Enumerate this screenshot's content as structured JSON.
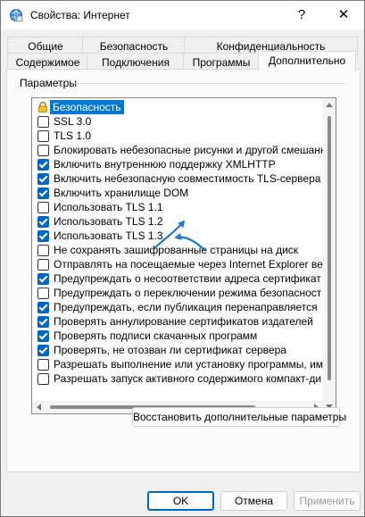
{
  "window": {
    "title": "Свойства: Интернет",
    "help_label": "?",
    "close_label": "✕"
  },
  "tabs": {
    "row1": [
      "Общие",
      "Безопасность",
      "Конфиденциальность"
    ],
    "row2": [
      "Содержимое",
      "Подключения",
      "Программы",
      "Дополнительно"
    ],
    "active": "Дополнительно"
  },
  "settings": {
    "group_label": "Параметры",
    "category": "Безопасность",
    "items": [
      {
        "label": "SSL 3.0",
        "checked": false
      },
      {
        "label": "TLS 1.0",
        "checked": false
      },
      {
        "label": "Блокировать небезопасные рисунки и другой смешанн",
        "checked": false
      },
      {
        "label": "Включить внутреннюю поддержку XMLHTTP",
        "checked": true
      },
      {
        "label": "Включить небезопасную совместимость TLS-сервера",
        "checked": true
      },
      {
        "label": "Включить хранилище DOM",
        "checked": true
      },
      {
        "label": "Использовать TLS 1.1",
        "checked": false
      },
      {
        "label": "Использовать TLS 1.2",
        "checked": true
      },
      {
        "label": "Использовать TLS 1.3",
        "checked": true
      },
      {
        "label": "Не сохранять зашифрованные страницы на диск",
        "checked": false
      },
      {
        "label": "Отправлять на посещаемые через Internet Explorer ве",
        "checked": false
      },
      {
        "label": "Предупреждать о несоответствии адреса сертификат",
        "checked": true
      },
      {
        "label": "Предупреждать о переключении режима безопасност",
        "checked": false
      },
      {
        "label": "Предупреждать, если публикация перенаправляется",
        "checked": true
      },
      {
        "label": "Проверять аннулирование сертификатов издателей",
        "checked": true
      },
      {
        "label": "Проверять подписи скачанных программ",
        "checked": true
      },
      {
        "label": "Проверять, не отозван ли сертификат сервера",
        "checked": true
      },
      {
        "label": "Разрешать выполнение или установку программы, име",
        "checked": false
      },
      {
        "label": "Разрешать запуск активного содержимого компакт-ди",
        "checked": false
      }
    ]
  },
  "buttons": {
    "restore": "Восстановить дополнительные параметры",
    "ok": "OK",
    "cancel": "Отмена",
    "apply": "Применить"
  },
  "colors": {
    "accent": "#0067c0",
    "annotation_arrow": "#1a7ad4",
    "selection": "#0078d7"
  },
  "icons": {
    "window": "internet-options-icon",
    "category": "lock-icon"
  }
}
